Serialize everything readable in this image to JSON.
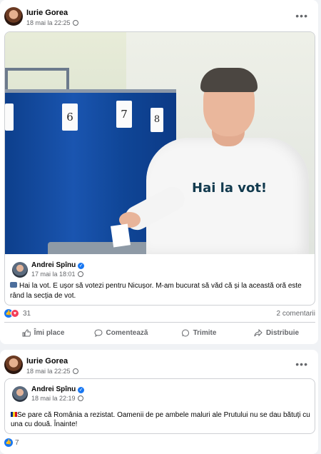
{
  "post1": {
    "author": "Iurie Gorea",
    "timestamp": "18 mai la 22:25",
    "privacy_icon": "globe-icon",
    "more_label": "•••",
    "photo": {
      "booth_numbers": [
        "6",
        "7",
        "8"
      ],
      "shirt_text": "Hai la vot!"
    },
    "shared": {
      "author": "Andrei Spînu",
      "verified": true,
      "timestamp": "17 mai la 18:01",
      "text": "Hai la vot. E ușor să votezi pentru Nicușor. M-am bucurat să văd că și la această oră este rând la secția de vot."
    },
    "reactions": {
      "count": "31",
      "types": [
        "like",
        "love"
      ]
    },
    "comments": "2 comentarii",
    "actions": [
      {
        "label": "Îmi place",
        "icon": "thumbs-up-icon"
      },
      {
        "label": "Comentează",
        "icon": "comment-icon"
      },
      {
        "label": "Trimite",
        "icon": "whatsapp-icon"
      },
      {
        "label": "Distribuie",
        "icon": "share-icon"
      }
    ]
  },
  "post2": {
    "author": "Iurie Gorea",
    "timestamp": "18 mai la 22:25",
    "more_label": "•••",
    "shared": {
      "author": "Andrei Spînu",
      "verified": true,
      "timestamp": "18 mai la 22:19",
      "text": "Se pare că România a rezistat. Oamenii de pe ambele maluri ale Prutului nu se dau bătuți cu una cu două. Înainte!"
    },
    "reactions": {
      "count": "7",
      "types": [
        "like"
      ]
    }
  },
  "colors": {
    "accent": "#1877f2",
    "love": "#f33e58",
    "meta": "#65676b"
  }
}
